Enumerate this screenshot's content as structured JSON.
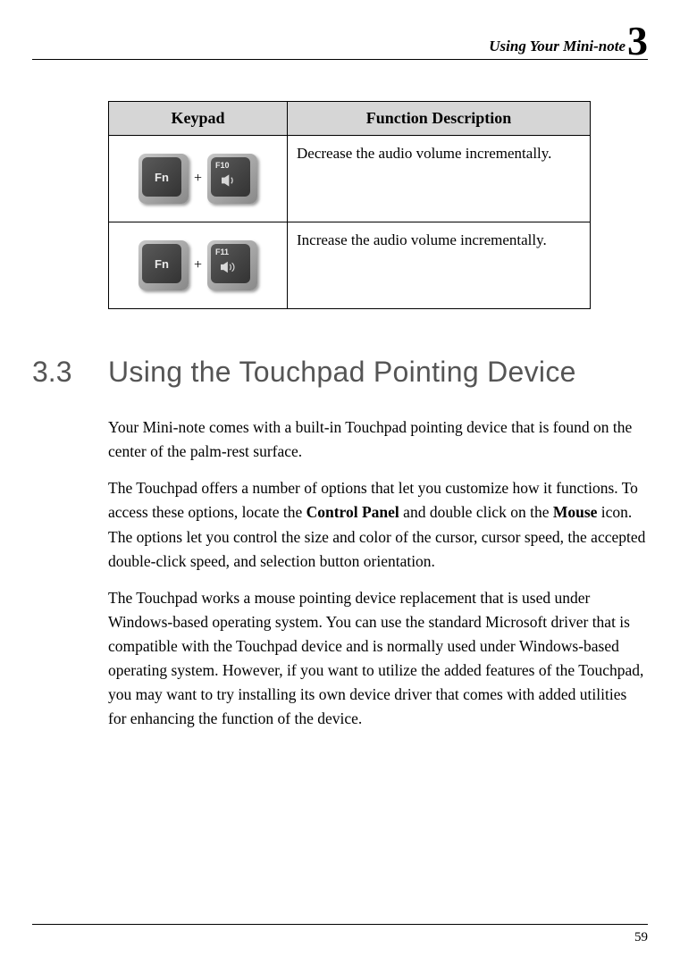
{
  "header": {
    "text": "Using Your Mini-note",
    "chapter_num": "3"
  },
  "table": {
    "col1_header": "Keypad",
    "col2_header": "Function Description",
    "rows": [
      {
        "key1_label": "Fn",
        "plus": "+",
        "key2_label": "F10",
        "description": "Decrease the audio volume incrementally."
      },
      {
        "key1_label": "Fn",
        "plus": "+",
        "key2_label": "F11",
        "description": "Increase the audio volume incrementally."
      }
    ]
  },
  "section": {
    "number": "3.3",
    "title": "Using the Touchpad Pointing Device"
  },
  "paragraphs": {
    "p1": "Your Mini-note comes with a built-in Touchpad pointing device that is found on the center of the palm-rest surface.",
    "p2_pre": "The Touchpad offers a number of options that let you customize how it functions. To access these options, locate the ",
    "p2_bold1": "Control Panel",
    "p2_mid": " and double click on the ",
    "p2_bold2": "Mouse",
    "p2_post": " icon. The options let you control the size and color of the cursor, cursor speed, the accepted double-click speed, and selection button orientation.",
    "p3": "The Touchpad works a mouse pointing device replacement that is used under Windows-based operating system. You can use the standard Microsoft driver that is compatible with the Touchpad device and is normally used under Windows-based operating system. However, if you want to utilize the added features of the Touchpad, you may want to try installing its own device driver that comes with added utilities for enhancing the function of the device."
  },
  "footer": {
    "page_num": "59"
  }
}
